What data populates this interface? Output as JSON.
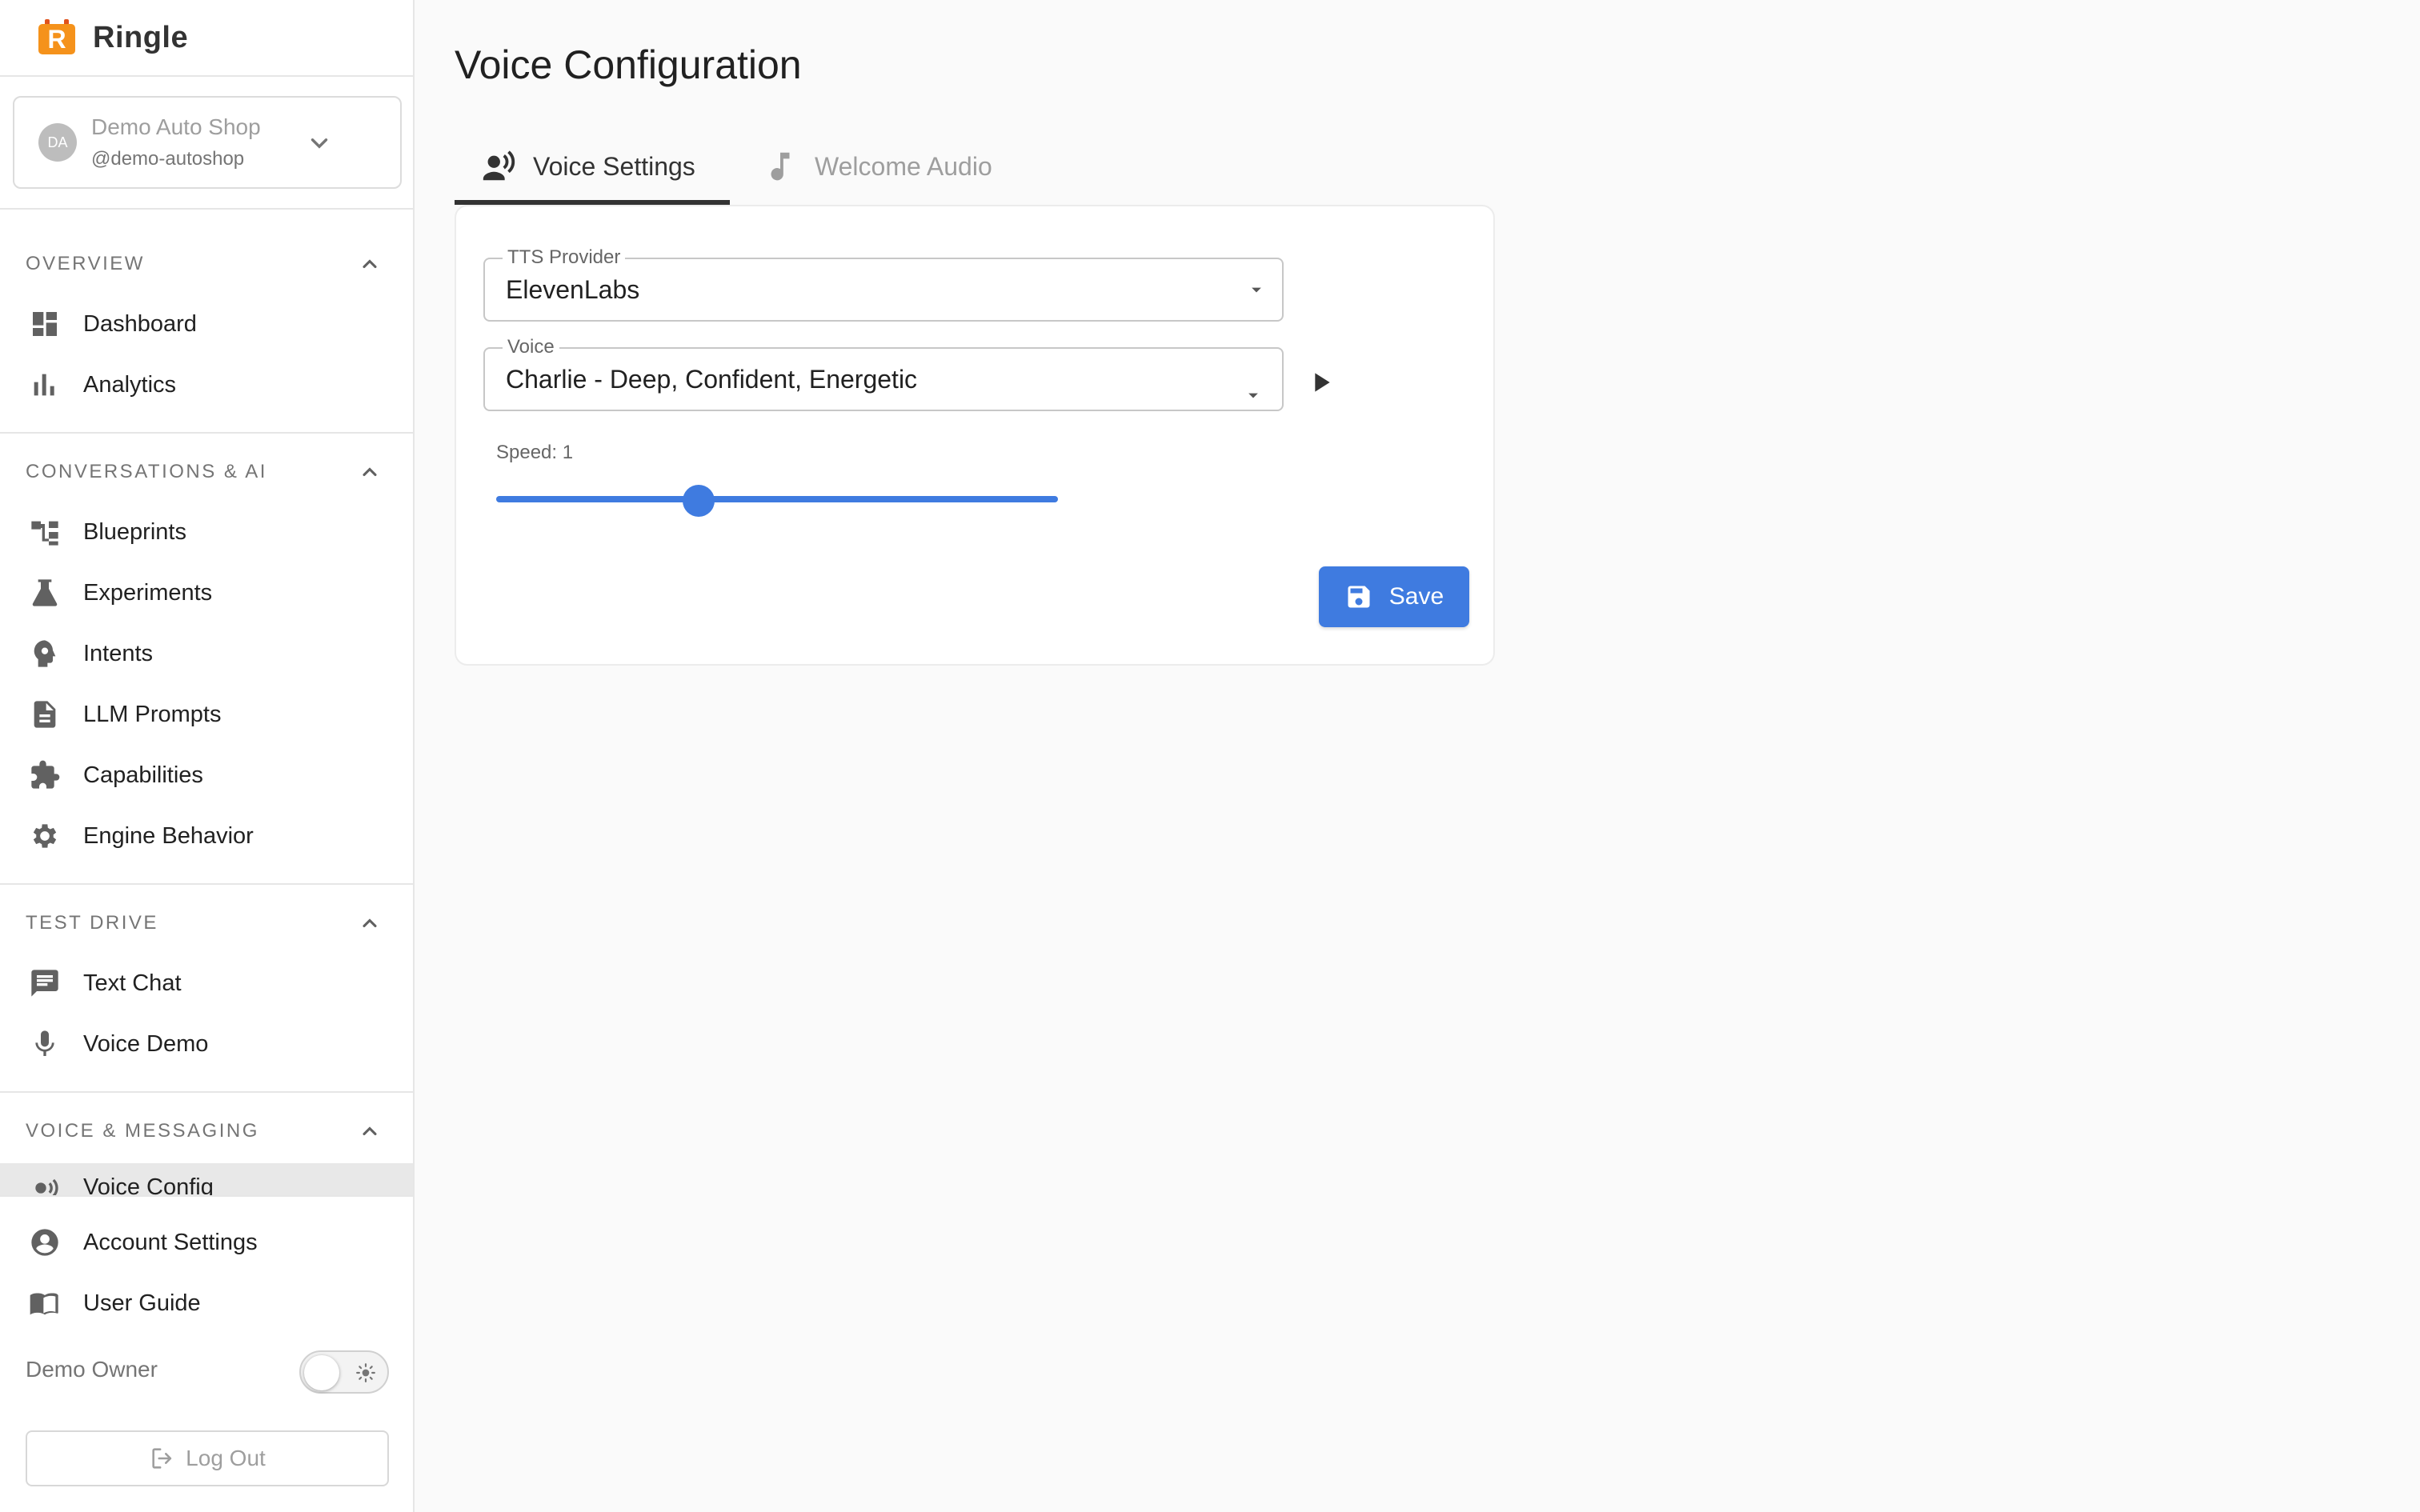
{
  "brand": {
    "name": "Ringle",
    "logo_letter": "R",
    "logo_color": "#f5921b"
  },
  "account": {
    "initials": "DA",
    "name": "Demo Auto Shop",
    "handle": "@demo-autoshop"
  },
  "sidebar": {
    "sections": [
      {
        "title": "OVERVIEW",
        "items": [
          {
            "label": "Dashboard",
            "icon": "dashboard-icon"
          },
          {
            "label": "Analytics",
            "icon": "bar-chart-icon"
          }
        ]
      },
      {
        "title": "CONVERSATIONS & AI",
        "items": [
          {
            "label": "Blueprints",
            "icon": "flowchart-icon"
          },
          {
            "label": "Experiments",
            "icon": "flask-icon"
          },
          {
            "label": "Intents",
            "icon": "brain-icon"
          },
          {
            "label": "LLM Prompts",
            "icon": "document-icon"
          },
          {
            "label": "Capabilities",
            "icon": "puzzle-icon"
          },
          {
            "label": "Engine Behavior",
            "icon": "gear-icon"
          }
        ]
      },
      {
        "title": "TEST DRIVE",
        "items": [
          {
            "label": "Text Chat",
            "icon": "chat-icon"
          },
          {
            "label": "Voice Demo",
            "icon": "microphone-icon"
          }
        ]
      },
      {
        "title": "VOICE & MESSAGING",
        "items": [
          {
            "label": "Voice Config",
            "icon": "voice-icon",
            "active": true
          }
        ]
      }
    ],
    "footer_items": [
      {
        "label": "Account Settings",
        "icon": "account-circle-icon"
      },
      {
        "label": "User Guide",
        "icon": "book-icon"
      }
    ],
    "owner_label": "Demo Owner",
    "theme_toggle_icon": "sun-icon",
    "logout_label": "Log Out"
  },
  "main": {
    "title": "Voice Configuration",
    "tabs": [
      {
        "label": "Voice Settings",
        "icon": "voice-person-icon",
        "active": true
      },
      {
        "label": "Welcome Audio",
        "icon": "music-note-icon",
        "active": false
      }
    ],
    "form": {
      "tts_provider": {
        "label": "TTS Provider",
        "value": "ElevenLabs"
      },
      "voice": {
        "label": "Voice",
        "value": "Charlie - Deep, Confident, Energetic"
      },
      "speed": {
        "label": "Speed: 1",
        "value_fraction": 0.36
      },
      "save_label": "Save"
    }
  },
  "colors": {
    "accent": "#3f7be0",
    "active_nav_bg": "#e8e8e8",
    "text_muted": "#757575"
  }
}
